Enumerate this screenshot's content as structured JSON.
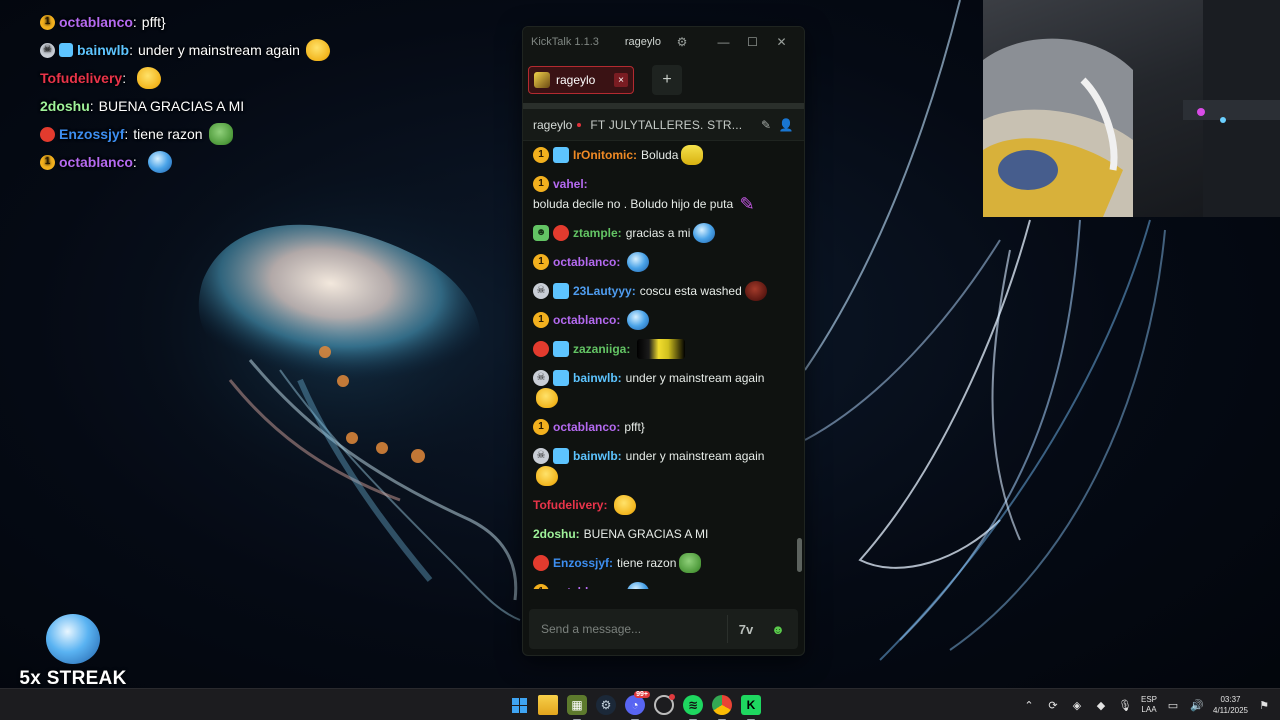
{
  "overlay_chat": [
    {
      "badges": [
        "gold"
      ],
      "user": "octablanco",
      "user_color": "#b46af0",
      "sep": ":",
      "text": "pfft}",
      "emote": ""
    },
    {
      "badges": [
        "skull",
        "sub"
      ],
      "user": "bainwlb",
      "user_color": "#5dc4ff",
      "sep": ":",
      "text": "under y mainstream again",
      "emote": "duck"
    },
    {
      "badges": [],
      "user": "Tofudelivery",
      "user_color": "#e8344a",
      "sep": ":",
      "text": "",
      "emote": "duck"
    },
    {
      "badges": [],
      "user": "2doshu",
      "user_color": "#9ff29a",
      "sep": ":",
      "text": "BUENA GRACIAS A MI",
      "emote": ""
    },
    {
      "badges": [
        "red"
      ],
      "user": "Enzossjyf",
      "user_color": "#3d8ef0",
      "sep": ":",
      "text": "tiene razon",
      "emote": "frog"
    },
    {
      "badges": [
        "gold"
      ],
      "user": "octablanco",
      "user_color": "#b46af0",
      "sep": ":",
      "text": "",
      "emote": "globe"
    }
  ],
  "streak": {
    "label": "5x STREAK",
    "emote": "globe"
  },
  "kicktalk": {
    "app_title": "KickTalk 1.1.3",
    "username": "rageylo",
    "tab_label": "rageylo",
    "add_tab": "+",
    "close_tab": "×",
    "channel_name": "rageylo",
    "stream_title": "FT JULYTALLERES. STR...",
    "input_placeholder": "Send a message...",
    "emote_btn_7tv": "7v",
    "scroll_position_fraction": 0.96,
    "messages": [
      {
        "badges": [
          "gold",
          "sub"
        ],
        "user": "IrOnitomic",
        "user_color": "#f08a25",
        "text": "Boluda",
        "emote": "sticker"
      },
      {
        "badges": [
          "gold"
        ],
        "user": "vahel",
        "user_color": "#b46af0",
        "text": "boluda decile no . Boludo hijo de puta",
        "emote": "feather"
      },
      {
        "badges": [
          "bot",
          "red"
        ],
        "user": "ztample",
        "user_color": "#63c464",
        "text": "gracias a mi",
        "emote": "globe"
      },
      {
        "badges": [
          "gold"
        ],
        "user": "octablanco",
        "user_color": "#b46af0",
        "text": "",
        "emote": "globe"
      },
      {
        "badges": [
          "skull",
          "sub"
        ],
        "user": "23Lautyyy",
        "user_color": "#4f9df0",
        "text": "coscu esta washed",
        "emote": "brown"
      },
      {
        "badges": [
          "gold"
        ],
        "user": "octablanco",
        "user_color": "#b46af0",
        "text": "",
        "emote": "globe"
      },
      {
        "badges": [
          "red",
          "sub"
        ],
        "user": "zazaniiga",
        "user_color": "#63c464",
        "text": "",
        "emote": "wide"
      },
      {
        "badges": [
          "skull",
          "sub"
        ],
        "user": "bainwlb",
        "user_color": "#5dc4ff",
        "text": "under y mainstream again",
        "emote": "duck"
      },
      {
        "badges": [
          "gold"
        ],
        "user": "octablanco",
        "user_color": "#b46af0",
        "text": "pfft}",
        "emote": ""
      },
      {
        "badges": [
          "skull",
          "sub"
        ],
        "user": "bainwlb",
        "user_color": "#5dc4ff",
        "text": "under y mainstream again",
        "emote": "duck"
      },
      {
        "badges": [],
        "user": "Tofudelivery",
        "user_color": "#e8344a",
        "text": "",
        "emote": "duck"
      },
      {
        "badges": [],
        "user": "2doshu",
        "user_color": "#9ff29a",
        "text": "BUENA GRACIAS A MI",
        "emote": ""
      },
      {
        "badges": [
          "red"
        ],
        "user": "Enzossjyf",
        "user_color": "#3d8ef0",
        "text": "tiene razon",
        "emote": "frog"
      },
      {
        "badges": [
          "gold"
        ],
        "user": "octablanco",
        "user_color": "#b46af0",
        "text": "",
        "emote": "globe"
      }
    ]
  },
  "taskbar": {
    "apps": [
      "windows-start",
      "file-explorer",
      "game-launcher",
      "steam",
      "discord",
      "clock-app",
      "spotify",
      "chrome",
      "kick"
    ],
    "discord_badge": "99+",
    "language_top": "ESP",
    "language_bottom": "LAA",
    "time": "03:37",
    "date": "4/11/2025"
  },
  "colors": {
    "accent_kick": "#53fc18",
    "tab_active_border": "#b42a30",
    "live_dot": "#e0323b"
  }
}
